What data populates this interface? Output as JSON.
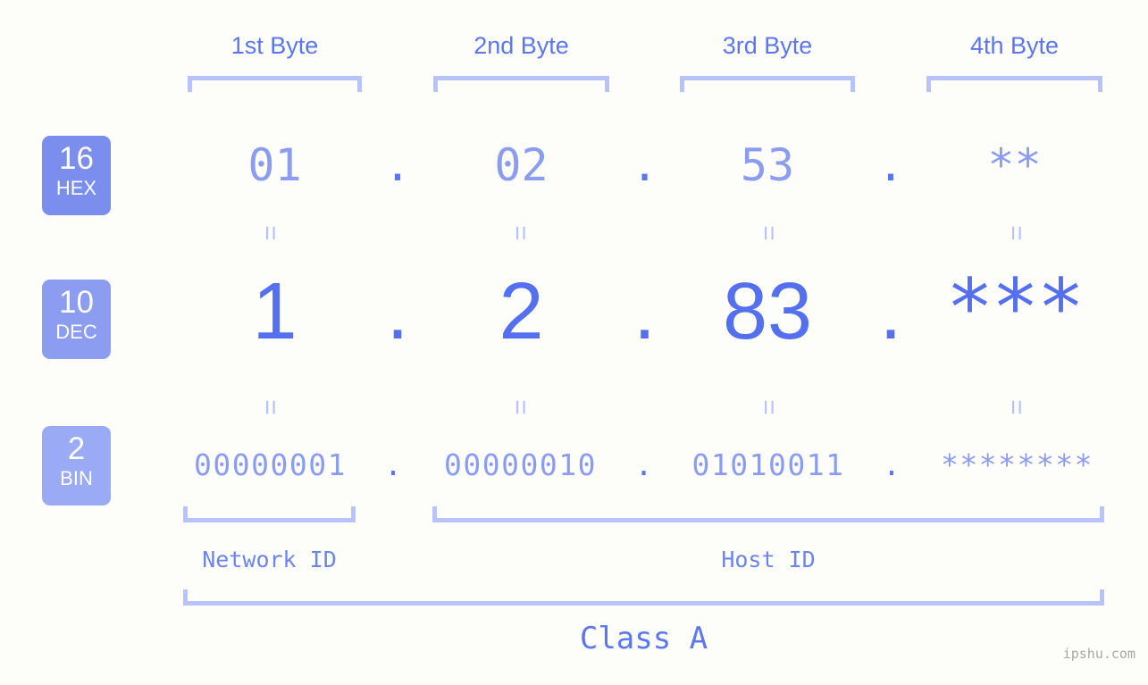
{
  "meta": {
    "background_color": "#fdfefa",
    "accent_color": "#5570ef",
    "light_accent_color": "#8b9cf1",
    "bracket_color": "#b9c3fb",
    "watermark": "ipshu.com"
  },
  "byte_headers": [
    {
      "label": "1st Byte"
    },
    {
      "label": "2nd Byte"
    },
    {
      "label": "3rd Byte"
    },
    {
      "label": "4th Byte"
    }
  ],
  "radix_badges": [
    {
      "number": "16",
      "name": "HEX",
      "color": "#7b8eee"
    },
    {
      "number": "10",
      "name": "DEC",
      "color": "#8b9cf1"
    },
    {
      "number": "2",
      "name": "BIN",
      "color": "#9aaaf5"
    }
  ],
  "rows": {
    "hex": {
      "radix": "16",
      "radix_name": "HEX",
      "values": [
        "01",
        "02",
        "53",
        "**"
      ],
      "separators": [
        ".",
        ".",
        "."
      ]
    },
    "dec": {
      "radix": "10",
      "radix_name": "DEC",
      "values": [
        "1",
        "2",
        "83",
        "***"
      ],
      "separators": [
        ".",
        ".",
        "."
      ]
    },
    "bin": {
      "radix": "2",
      "radix_name": "BIN",
      "values": [
        "00000001",
        "00000010",
        "01010011",
        "********"
      ],
      "separators": [
        ".",
        ".",
        "."
      ]
    }
  },
  "equals_marks": {
    "symbol": "=",
    "count_per_row": 4
  },
  "sections": [
    {
      "label": "Network ID"
    },
    {
      "label": "Host ID"
    }
  ],
  "class": {
    "label": "Class A"
  }
}
